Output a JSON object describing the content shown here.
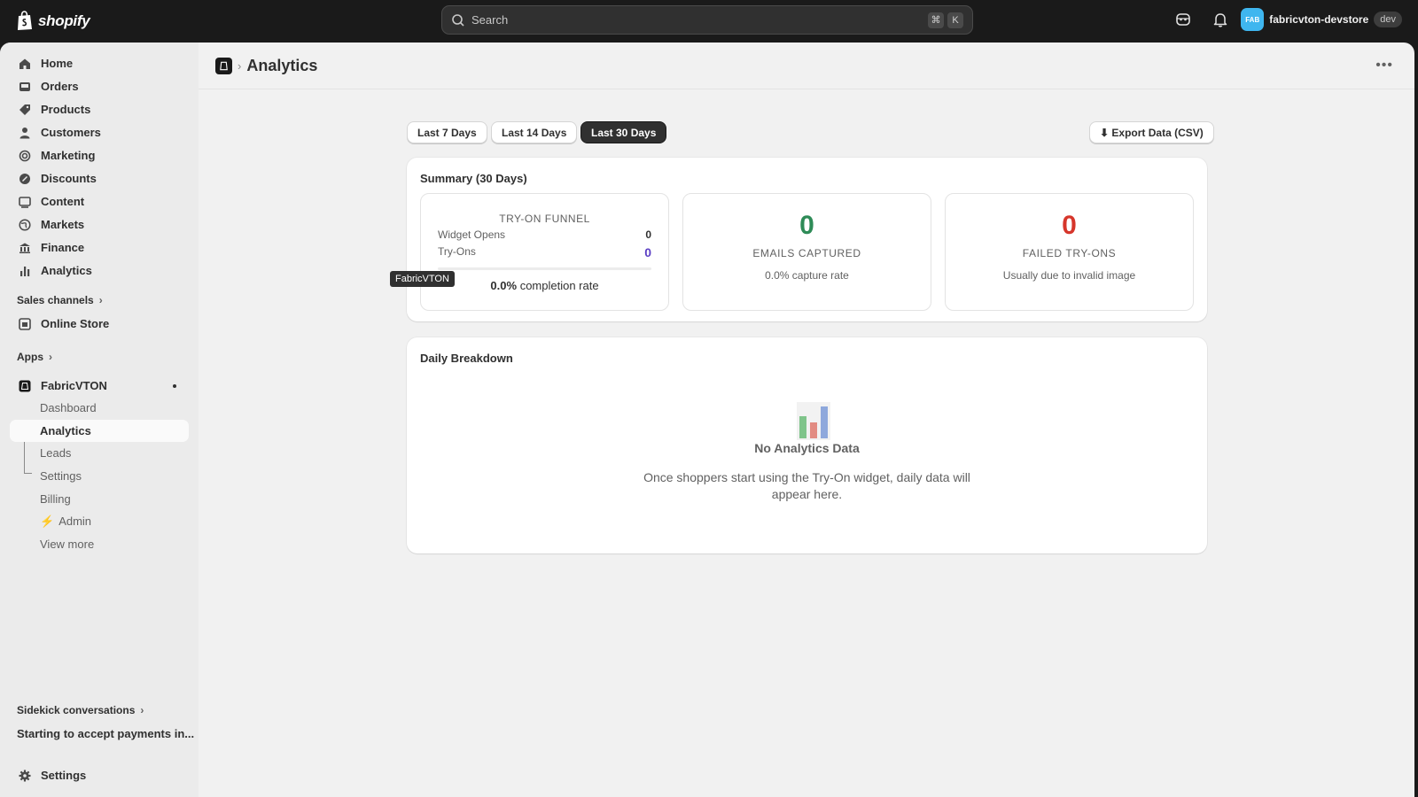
{
  "topbar": {
    "logo_text": "shopify",
    "search_placeholder": "Search",
    "shortcut_keys": [
      "⌘",
      "K"
    ],
    "store_avatar": "FAB",
    "store_name": "fabricvton-devstore",
    "store_badge": "dev"
  },
  "sidebar": {
    "items": [
      {
        "label": "Home",
        "icon": "home-icon"
      },
      {
        "label": "Orders",
        "icon": "inbox-icon"
      },
      {
        "label": "Products",
        "icon": "tag-icon"
      },
      {
        "label": "Customers",
        "icon": "person-icon"
      },
      {
        "label": "Marketing",
        "icon": "target-icon"
      },
      {
        "label": "Discounts",
        "icon": "discount-icon"
      },
      {
        "label": "Content",
        "icon": "content-icon"
      },
      {
        "label": "Markets",
        "icon": "globe-icon"
      },
      {
        "label": "Finance",
        "icon": "bank-icon"
      },
      {
        "label": "Analytics",
        "icon": "bar-chart-icon"
      }
    ],
    "sales_channels_label": "Sales channels",
    "online_store_label": "Online Store",
    "apps_label": "Apps",
    "app_name": "FabricVTON",
    "app_subitems": [
      "Dashboard",
      "Analytics",
      "Leads",
      "Settings",
      "Billing",
      "Admin",
      "View more"
    ],
    "sidekick_label": "Sidekick conversations",
    "sidekick_item": "Starting to accept payments in...",
    "settings_label": "Settings"
  },
  "page": {
    "title": "Analytics",
    "tooltip": "FabricVTON",
    "range_buttons": [
      "Last 7 Days",
      "Last 14 Days",
      "Last 30 Days"
    ],
    "selected_range": "Last 30 Days",
    "export_label": "⬇ Export Data (CSV)"
  },
  "summary": {
    "title": "Summary (30 Days)",
    "funnel_title": "TRY-ON FUNNEL",
    "widget_opens_label": "Widget Opens",
    "widget_opens_value": "0",
    "tryons_label": "Try-Ons",
    "tryons_value": "0",
    "completion_value": "0.0%",
    "completion_text": "completion rate",
    "emails_value": "0",
    "emails_label": "EMAILS CAPTURED",
    "emails_sub": "0.0% capture rate",
    "failed_value": "0",
    "failed_label": "FAILED TRY-ONS",
    "failed_sub": "Usually due to invalid image"
  },
  "daily": {
    "title": "Daily Breakdown",
    "empty_title": "No Analytics Data",
    "empty_text": "Once shoppers start using the Try-On widget, daily data will appear here."
  },
  "colors": {
    "green": "#2e8b57",
    "red": "#d6362b",
    "purple": "#5b3fc4",
    "avatar": "#3fb6ef"
  }
}
